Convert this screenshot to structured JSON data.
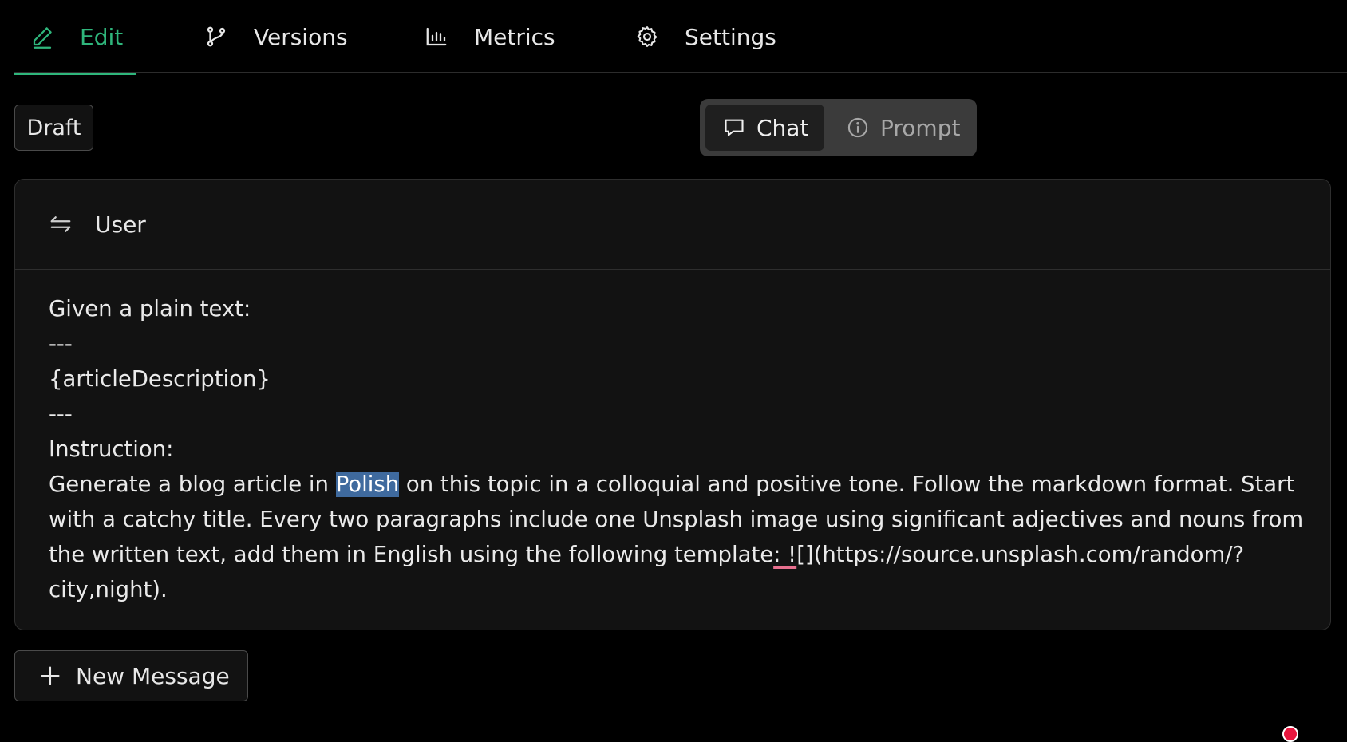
{
  "tabs": {
    "edit": {
      "label": "Edit",
      "icon": "pencil-icon",
      "active": true
    },
    "versions": {
      "label": "Versions",
      "icon": "git-branch-icon"
    },
    "metrics": {
      "label": "Metrics",
      "icon": "bar-chart-icon"
    },
    "settings": {
      "label": "Settings",
      "icon": "gear-icon"
    }
  },
  "status": {
    "draft_label": "Draft"
  },
  "mode_toggle": {
    "chat_label": "Chat",
    "chat_icon": "message-bubble-icon",
    "prompt_label": "Prompt",
    "prompt_icon": "info-icon",
    "selected": "Chat"
  },
  "message": {
    "role_label": "User",
    "role_icon": "swap-arrows-icon",
    "lines": {
      "l1": "Given a plain text:",
      "l2": "---",
      "l3": "{articleDescription}",
      "l4": "---",
      "l5": "Instruction:",
      "l6_before": "Generate a blog article in ",
      "l6_selected": "Polish",
      "l6_after": " on this topic in a colloquial and positive tone. Follow the markdown format. Start with a catchy title. Every two paragraphs include one Unsplash image using significant adjectives and nouns from the written text, add them in English using the following template",
      "l6_flagged": ": !",
      "l6_end": "[](https://source.unsplash.com/random/?city,night)."
    }
  },
  "actions": {
    "new_message_label": "New Message",
    "new_message_icon": "plus-icon"
  },
  "colors": {
    "accent": "#2fb67c",
    "selection": "#3f6a9e",
    "record_dot": "#e8163e",
    "spellcheck_underline": "#e8708f"
  }
}
